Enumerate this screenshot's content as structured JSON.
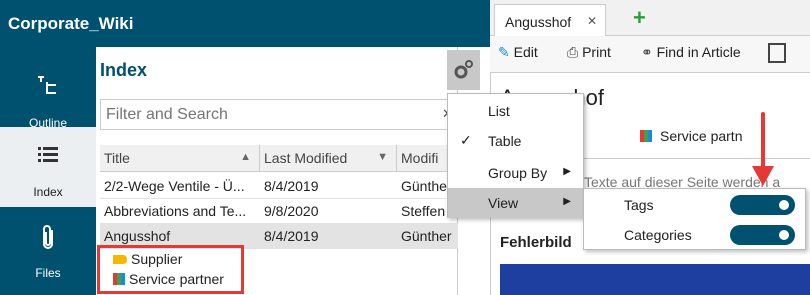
{
  "app": {
    "title": "Corporate_Wiki"
  },
  "nav": [
    {
      "label": "Outline"
    },
    {
      "label": "Index"
    },
    {
      "label": "Files"
    }
  ],
  "index": {
    "title": "Index",
    "filter_placeholder": "Filter and Search",
    "columns": [
      "Title",
      "Last Modified",
      "Modifi"
    ],
    "rows": [
      {
        "title": "2/2-Wege Ventile - Ü...",
        "modified": "8/4/2019",
        "by": "Günther"
      },
      {
        "title": "Abbreviations and Te...",
        "modified": "9/8/2020",
        "by": "Steffen"
      },
      {
        "title": "Angusshof",
        "modified": "8/4/2019",
        "by": "Günther"
      }
    ],
    "tags": [
      {
        "label": "Supplier",
        "kind": "tag"
      },
      {
        "label": "Service partner",
        "kind": "category"
      }
    ]
  },
  "menu": {
    "items": [
      {
        "label": "List",
        "checked": false,
        "submenu": false
      },
      {
        "label": "Table",
        "checked": true,
        "submenu": false
      },
      {
        "label": "Group By",
        "checked": false,
        "submenu": true
      },
      {
        "label": "View",
        "checked": false,
        "submenu": true
      }
    ],
    "view_submenu": [
      {
        "label": "Tags",
        "on": true
      },
      {
        "label": "Categories",
        "on": true
      }
    ]
  },
  "article": {
    "tab_label": "Angusshof",
    "toolbar": {
      "edit": "Edit",
      "print": "Print",
      "find": "Find in Article"
    },
    "title": "Angusshof",
    "category": "Service partn",
    "info_text": "Texte auf dieser Seite werden a",
    "section": "Fehlerbild"
  },
  "colors": {
    "brand": "#00506f",
    "highlight": "#e53935",
    "add": "#2e9e3a"
  }
}
